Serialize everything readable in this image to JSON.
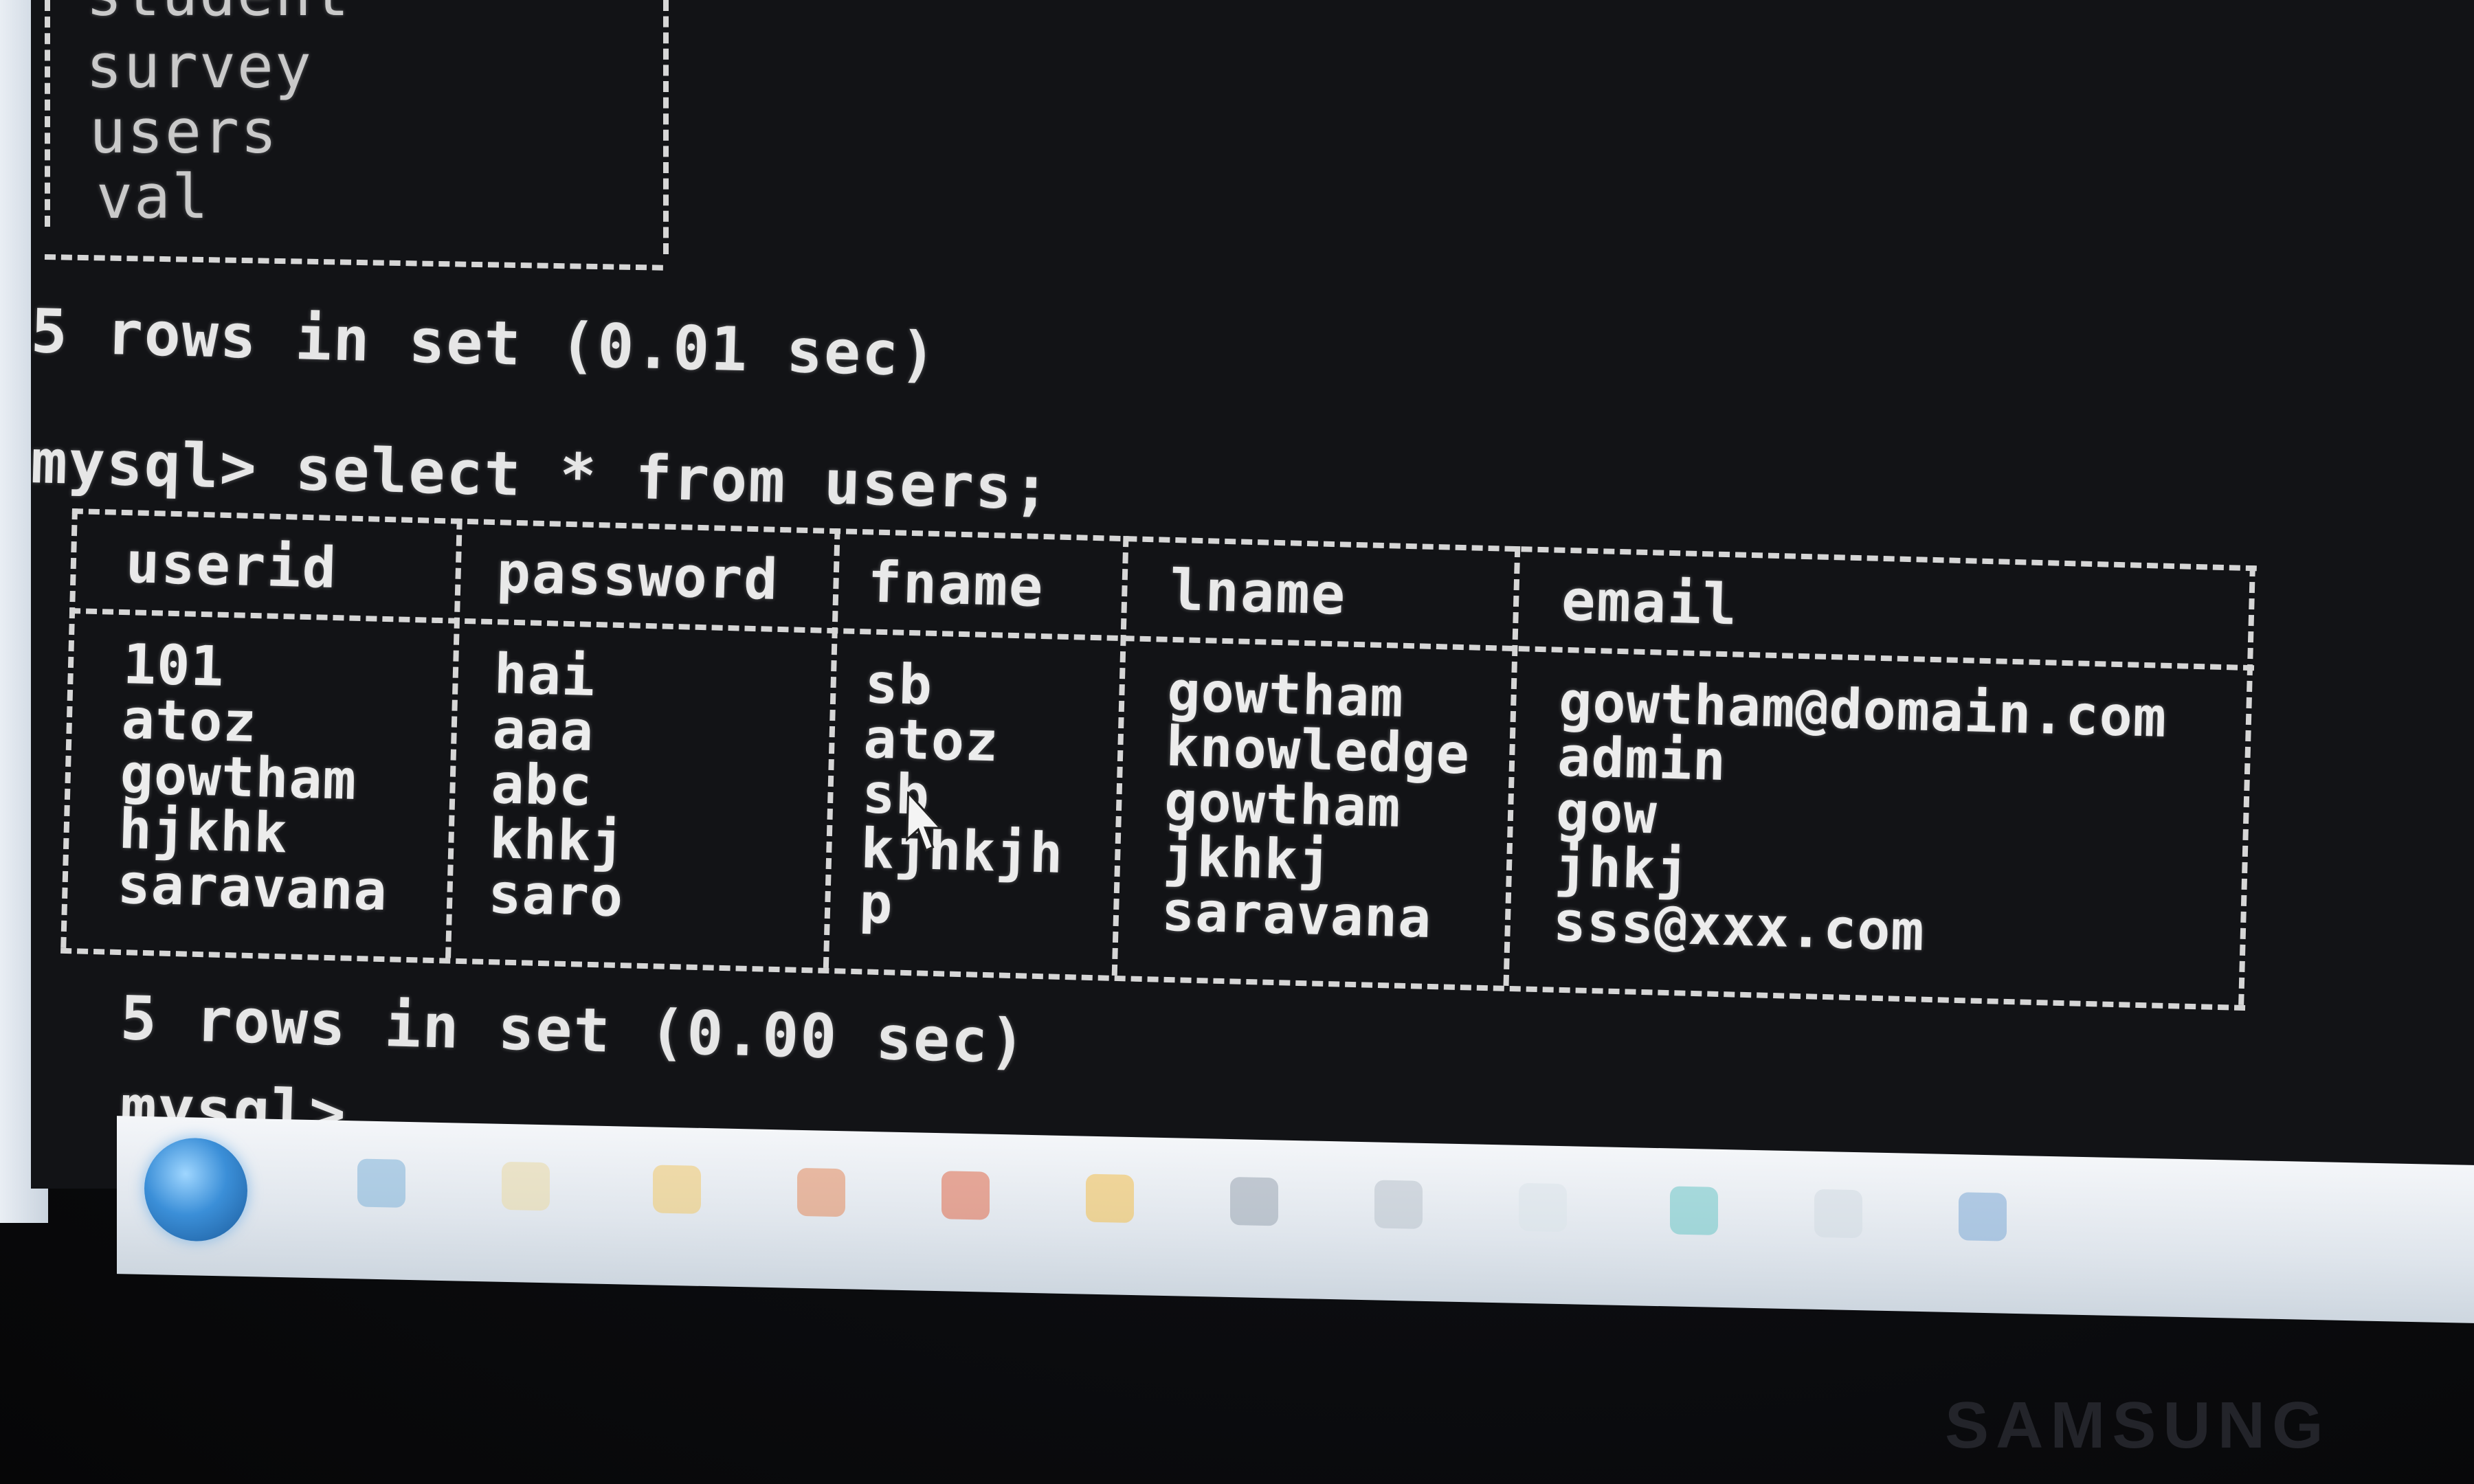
{
  "console": {
    "table_list": [
      "student",
      "survey",
      "users",
      "val"
    ],
    "result1": "5 rows in set (0.01 sec)",
    "command": "mysql> select * from users;",
    "table": {
      "columns": [
        "userid",
        "password",
        "fname",
        "lname",
        "email"
      ],
      "rows": [
        [
          "101",
          "hai",
          "sb",
          "gowtham",
          "gowtham@domain.com"
        ],
        [
          "atoz",
          "aaa",
          "atoz",
          "knowledge",
          "admin"
        ],
        [
          "gowtham",
          "abc",
          "sb",
          "gowtham",
          "gow"
        ],
        [
          "hjkhk",
          "khkj",
          "kjhkjh",
          "jkhkj",
          "jhkj"
        ],
        [
          "saravana",
          "saro",
          "p",
          "saravana",
          "sss@xxx.com"
        ]
      ]
    },
    "result2": "5 rows in set (0.00 sec)",
    "prompt": "mysql>"
  },
  "taskbar": {
    "icons": [
      "start-orb",
      "ie-icon",
      "folder-icon",
      "media-icon",
      "chrome-icon",
      "firefox-icon",
      "app-icon",
      "network-icon",
      "paint-icon",
      "skype-icon",
      "cmd-icon",
      "mysql-icon"
    ]
  },
  "monitor": {
    "brand": "SAMSUNG"
  }
}
